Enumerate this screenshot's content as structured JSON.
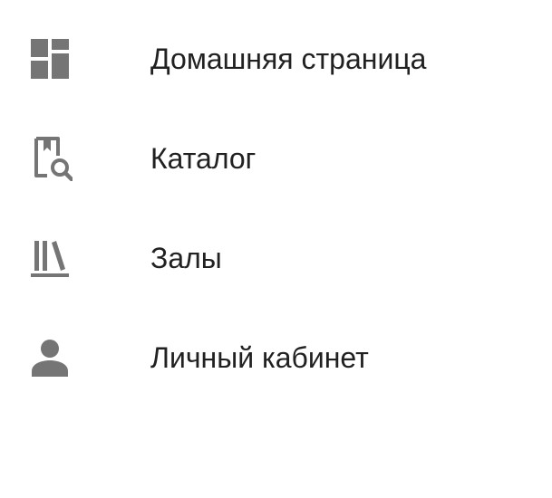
{
  "theme": {
    "icon_color": "#757575",
    "text_color": "#212121",
    "background": "#ffffff"
  },
  "nav": {
    "items": [
      {
        "id": "home",
        "label": "Домашняя страница",
        "icon": "dashboard-icon"
      },
      {
        "id": "catalog",
        "label": "Каталог",
        "icon": "book-search-icon"
      },
      {
        "id": "halls",
        "label": "Залы",
        "icon": "library-books-icon"
      },
      {
        "id": "account",
        "label": "Личный кабинет",
        "icon": "person-icon"
      }
    ]
  }
}
